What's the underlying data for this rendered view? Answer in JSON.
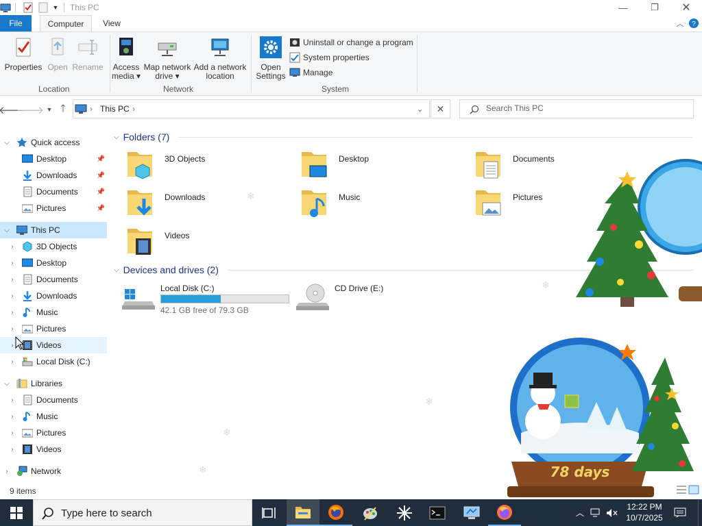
{
  "window": {
    "title": "This PC",
    "controls": [
      "minimize",
      "restore",
      "close"
    ]
  },
  "ribbon": {
    "tabs": {
      "file": "File",
      "computer": "Computer",
      "view": "View"
    },
    "location": {
      "label": "Location",
      "properties": "Properties",
      "open": "Open",
      "rename": "Rename"
    },
    "network": {
      "label": "Network",
      "access_media_l1": "Access",
      "access_media_l2": "media ▾",
      "map_drive_l1": "Map network",
      "map_drive_l2": "drive ▾",
      "add_location_l1": "Add a network",
      "add_location_l2": "location"
    },
    "system": {
      "label": "System",
      "open_settings_l1": "Open",
      "open_settings_l2": "Settings",
      "uninstall": "Uninstall or change a program",
      "system_properties": "System properties",
      "manage": "Manage"
    }
  },
  "address": {
    "crumb": "This PC",
    "search_placeholder": "Search This PC"
  },
  "nav": {
    "quick_access": "Quick access",
    "quick_items": [
      "Desktop",
      "Downloads",
      "Documents",
      "Pictures"
    ],
    "this_pc": "This PC",
    "pc_items": [
      "3D Objects",
      "Desktop",
      "Documents",
      "Downloads",
      "Music",
      "Pictures",
      "Videos",
      "Local Disk (C:)"
    ],
    "libraries": "Libraries",
    "lib_items": [
      "Documents",
      "Music",
      "Pictures",
      "Videos"
    ],
    "network": "Network"
  },
  "content": {
    "folders_header": "Folders (7)",
    "folders": [
      "3D Objects",
      "Desktop",
      "Documents",
      "Downloads",
      "Music",
      "Pictures",
      "Videos"
    ],
    "devices_header": "Devices and drives (2)",
    "drives": [
      {
        "name": "Local Disk (C:)",
        "free": "42.1 GB free of 79.3 GB",
        "used_fraction": 0.47
      },
      {
        "name": "CD Drive (E:)"
      }
    ],
    "wallpaper_text": "78 days"
  },
  "status": {
    "items": "9 items"
  },
  "taskbar": {
    "search_placeholder": "Type here to search",
    "time": "12:22 PM",
    "date": "10/7/2025",
    "apps": [
      "task-view",
      "file-explorer",
      "firefox-dev",
      "paint-tool",
      "sparkle-app",
      "terminal",
      "remote-desktop",
      "firefox"
    ]
  },
  "colors": {
    "accent": "#1979ca",
    "selection": "#cce8ff",
    "drive_bar": "#26a0da",
    "folder": "#f8d775",
    "taskbar": "#1f2d3d"
  }
}
